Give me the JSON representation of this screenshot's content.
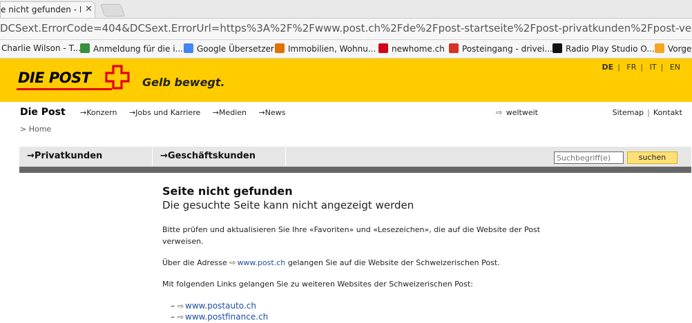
{
  "browser": {
    "tab_title": "e nicht gefunden - Die",
    "tab_close": "✕",
    "url": "DCSext.ErrorCode=404&DCSext.ErrorUrl=https%3A%2F%2Fwww.post.ch%2Fde%2Fpost-startseite%2Fpost-privatkunden%2Fpost-versenden%2",
    "bookmarks": [
      {
        "label": "Charlie Wilson - T...",
        "color": "#cccccc"
      },
      {
        "label": "Anmeldung für die i...",
        "color": "#3a8f3a"
      },
      {
        "label": "Google Übersetzer",
        "color": "#4285f4"
      },
      {
        "label": "Immobilien, Wohnu...",
        "color": "#e07000"
      },
      {
        "label": "newhome.ch",
        "color": "#d0021b"
      },
      {
        "label": "Posteingang - drivei...",
        "color": "#d93025"
      },
      {
        "label": "Radio Play Studio O...",
        "color": "#111111"
      },
      {
        "label": "Vorge",
        "color": "#f5a623"
      }
    ]
  },
  "header": {
    "logo_text": "DIE POST",
    "slogan": "Gelb bewegt.",
    "languages": [
      "DE",
      "FR",
      "IT",
      "EN"
    ],
    "active_language": "DE",
    "yellow": "#ffcc00",
    "red": "#e2001a"
  },
  "topnav": {
    "brand": "Die Post",
    "items": [
      "→Konzern",
      "→Jobs und Karriere",
      "→Medien",
      "→News"
    ],
    "weltweit": "weltweit",
    "sitemap": "Sitemap",
    "kontakt": "Kontakt",
    "breadcrumb": "> Home"
  },
  "mainnav": {
    "privat": "→Privatkunden",
    "geschaeft": "→Geschäftskunden",
    "search_placeholder": "Suchbegriff(e)",
    "search_button": "suchen"
  },
  "content": {
    "title": "Seite nicht gefunden",
    "subtitle": "Die gesuchte Seite kann nicht angezeigt werden",
    "para1": "Bitte prüfen und aktualisieren Sie Ihre «Favoriten» und «Lesezeichen», die auf die Website der Post verweisen.",
    "para2_before": "Über die Adresse",
    "para2_link": "www.post.ch",
    "para2_after": "gelangen Sie auf die Website der Schweizerischen Post.",
    "para3": "Mit folgenden Links gelangen Sie zu weiteren Websites der Schweizerischen Post:",
    "links": [
      "www.postauto.ch",
      "www.postfinance.ch"
    ]
  }
}
